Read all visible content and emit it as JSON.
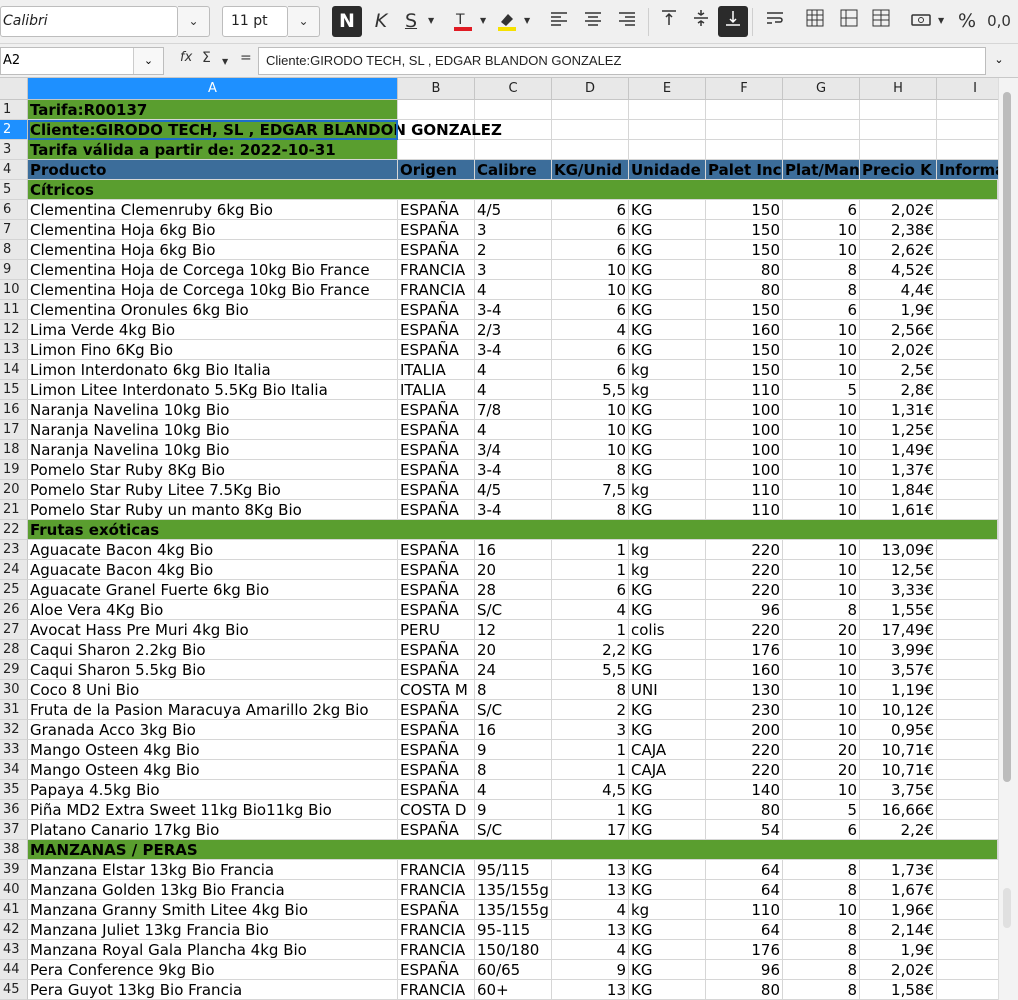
{
  "toolbar": {
    "font_name": "Calibri",
    "font_size": "11 pt",
    "bold_label": "N",
    "italic_label": "K",
    "underline_label": "S",
    "percent_label": "%",
    "decimals_label": "0,0"
  },
  "formula_bar": {
    "cell_ref": "A2",
    "fx_label": "fx",
    "sum_label": "Σ",
    "equals_label": "=",
    "content": "Cliente:GIRODO TECH, SL , EDGAR BLANDON GONZALEZ"
  },
  "columns": [
    "A",
    "B",
    "C",
    "D",
    "E",
    "F",
    "G",
    "H",
    "I"
  ],
  "header_row": [
    "Producto",
    "Origen",
    "Calibre",
    "KG/Unid",
    "Unidade",
    "Palet Inc",
    "Plat/Man",
    "Precio K",
    "Informa"
  ],
  "info_rows": [
    {
      "num": "1",
      "text": "Tarifa:R00137"
    },
    {
      "num": "2",
      "text": "Cliente:GIRODO TECH, SL , EDGAR BLANDON GONZALEZ"
    },
    {
      "num": "3",
      "text": "Tarifa válida a partir de: 2022-10-31"
    }
  ],
  "rows": [
    {
      "num": "5",
      "section": "Cítricos"
    },
    {
      "num": "6",
      "cells": [
        "Clementina Clemenruby 6kg  Bio",
        "ESPAÑA",
        "4/5",
        "6",
        "KG",
        "150",
        "6",
        "2,02€"
      ]
    },
    {
      "num": "7",
      "cells": [
        "Clementina Hoja 6kg Bio",
        "ESPAÑA",
        "3",
        "6",
        "KG",
        "150",
        "10",
        "2,38€"
      ]
    },
    {
      "num": "8",
      "cells": [
        "Clementina Hoja 6kg Bio",
        "ESPAÑA",
        "2",
        "6",
        "KG",
        "150",
        "10",
        "2,62€"
      ]
    },
    {
      "num": "9",
      "cells": [
        "Clementina Hoja de Corcega 10kg Bio France",
        "FRANCIA",
        "3",
        "10",
        "KG",
        "80",
        "8",
        "4,52€"
      ]
    },
    {
      "num": "10",
      "cells": [
        "Clementina Hoja de Corcega 10kg Bio France",
        "FRANCIA",
        "4",
        "10",
        "KG",
        "80",
        "8",
        "4,4€"
      ]
    },
    {
      "num": "11",
      "cells": [
        "Clementina Oronules 6kg Bio",
        "ESPAÑA",
        "3-4",
        "6",
        "KG",
        "150",
        "6",
        "1,9€"
      ]
    },
    {
      "num": "12",
      "cells": [
        "Lima Verde 4kg Bio",
        "ESPAÑA",
        "2/3",
        "4",
        "KG",
        "160",
        "10",
        "2,56€"
      ]
    },
    {
      "num": "13",
      "cells": [
        "Limon Fino 6Kg Bio",
        "ESPAÑA",
        "3-4",
        "6",
        "KG",
        "150",
        "10",
        "2,02€"
      ]
    },
    {
      "num": "14",
      "cells": [
        "Limon Interdonato 6kg Bio Italia",
        "ITALIA",
        "4",
        "6",
        "kg",
        "150",
        "10",
        "2,5€"
      ]
    },
    {
      "num": "15",
      "cells": [
        "Limon Litee Interdonato 5.5Kg Bio Italia",
        "ITALIA",
        "4",
        "5,5",
        "kg",
        "110",
        "5",
        "2,8€"
      ]
    },
    {
      "num": "16",
      "cells": [
        "Naranja Navelina 10kg Bio",
        "ESPAÑA",
        "7/8",
        "10",
        "KG",
        "100",
        "10",
        "1,31€"
      ]
    },
    {
      "num": "17",
      "cells": [
        "Naranja Navelina 10kg Bio",
        "ESPAÑA",
        "4",
        "10",
        "KG",
        "100",
        "10",
        "1,25€"
      ]
    },
    {
      "num": "18",
      "cells": [
        "Naranja Navelina 10kg Bio",
        "ESPAÑA",
        "3/4",
        "10",
        "KG",
        "100",
        "10",
        "1,49€"
      ]
    },
    {
      "num": "19",
      "cells": [
        "Pomelo Star Ruby 8Kg Bio",
        "ESPAÑA",
        "3-4",
        "8",
        "KG",
        "100",
        "10",
        "1,37€"
      ]
    },
    {
      "num": "20",
      "cells": [
        "Pomelo Star Ruby Litee 7.5Kg Bio",
        "ESPAÑA",
        "4/5",
        "7,5",
        "kg",
        "110",
        "10",
        "1,84€"
      ]
    },
    {
      "num": "21",
      "cells": [
        "Pomelo Star Ruby un manto 8Kg Bio",
        "ESPAÑA",
        "3-4",
        "8",
        "KG",
        "110",
        "10",
        "1,61€"
      ]
    },
    {
      "num": "22",
      "section": "Frutas exóticas"
    },
    {
      "num": "23",
      "cells": [
        "Aguacate Bacon 4kg Bio",
        "ESPAÑA",
        "16",
        "1",
        "kg",
        "220",
        "10",
        "13,09€"
      ]
    },
    {
      "num": "24",
      "cells": [
        "Aguacate Bacon 4kg Bio",
        "ESPAÑA",
        "20",
        "1",
        "kg",
        "220",
        "10",
        "12,5€"
      ]
    },
    {
      "num": "25",
      "cells": [
        "Aguacate Granel Fuerte 6kg Bio",
        "ESPAÑA",
        "28",
        "6",
        "KG",
        "220",
        "10",
        "3,33€"
      ]
    },
    {
      "num": "26",
      "cells": [
        "Aloe Vera 4Kg  Bio",
        "ESPAÑA",
        "S/C",
        "4",
        "KG",
        "96",
        "8",
        "1,55€"
      ]
    },
    {
      "num": "27",
      "cells": [
        "Avocat Hass Pre Muri 4kg Bio",
        "PERU",
        "12",
        "1",
        "colis",
        "220",
        "20",
        "17,49€"
      ]
    },
    {
      "num": "28",
      "cells": [
        "Caqui Sharon 2.2kg  Bio",
        "ESPAÑA",
        "20",
        "2,2",
        "KG",
        "176",
        "10",
        "3,99€"
      ]
    },
    {
      "num": "29",
      "cells": [
        "Caqui Sharon 5.5kg  Bio",
        "ESPAÑA",
        "24",
        "5,5",
        "KG",
        "160",
        "10",
        "3,57€"
      ]
    },
    {
      "num": "30",
      "cells": [
        "Coco 8 Uni  Bio",
        "COSTA M",
        "8",
        "8",
        "UNI",
        "130",
        "10",
        "1,19€"
      ]
    },
    {
      "num": "31",
      "cells": [
        "Fruta de la Pasion Maracuya Amarillo 2kg Bio",
        "ESPAÑA",
        "S/C",
        "2",
        "KG",
        "230",
        "10",
        "10,12€"
      ]
    },
    {
      "num": "32",
      "cells": [
        "Granada Acco 3kg Bio",
        "ESPAÑA",
        "16",
        "3",
        "KG",
        "200",
        "10",
        "0,95€"
      ]
    },
    {
      "num": "33",
      "cells": [
        "Mango Osteen 4kg Bio",
        "ESPAÑA",
        "9",
        "1",
        "CAJA",
        "220",
        "20",
        "10,71€"
      ]
    },
    {
      "num": "34",
      "cells": [
        "Mango Osteen 4kg Bio",
        "ESPAÑA",
        "8",
        "1",
        "CAJA",
        "220",
        "20",
        "10,71€"
      ]
    },
    {
      "num": "35",
      "cells": [
        "Papaya 4.5kg Bio",
        "ESPAÑA",
        "4",
        "4,5",
        "KG",
        "140",
        "10",
        "3,75€"
      ]
    },
    {
      "num": "36",
      "cells": [
        "Piña MD2 Extra Sweet 11kg Bio11kg Bio",
        "COSTA D",
        "9",
        "1",
        "KG",
        "80",
        "5",
        "16,66€"
      ]
    },
    {
      "num": "37",
      "cells": [
        "Platano Canario 17kg Bio",
        "ESPAÑA",
        "S/C",
        "17",
        "KG",
        "54",
        "6",
        "2,2€"
      ]
    },
    {
      "num": "38",
      "section": "MANZANAS / PERAS"
    },
    {
      "num": "39",
      "cells": [
        "Manzana Elstar 13kg Bio Francia",
        "FRANCIA",
        "95/115",
        "13",
        "KG",
        "64",
        "8",
        "1,73€"
      ]
    },
    {
      "num": "40",
      "cells": [
        "Manzana Golden 13kg Bio Francia",
        "FRANCIA",
        "135/155g",
        "13",
        "KG",
        "64",
        "8",
        "1,67€"
      ]
    },
    {
      "num": "41",
      "cells": [
        "Manzana Granny Smith Litee 4kg Bio",
        "ESPAÑA",
        "135/155g",
        "4",
        "kg",
        "110",
        "10",
        "1,96€"
      ]
    },
    {
      "num": "42",
      "cells": [
        "Manzana Juliet 13kg Francia Bio",
        "FRANCIA",
        "95-115",
        "13",
        "KG",
        "64",
        "8",
        "2,14€"
      ]
    },
    {
      "num": "43",
      "cells": [
        "Manzana Royal Gala Plancha 4kg Bio",
        "FRANCIA",
        "150/180",
        "4",
        "KG",
        "176",
        "8",
        "1,9€"
      ]
    },
    {
      "num": "44",
      "cells": [
        "Pera Conference 9kg Bio",
        "ESPAÑA",
        "60/65",
        "9",
        "KG",
        "96",
        "8",
        "2,02€"
      ]
    },
    {
      "num": "45",
      "cells": [
        "Pera Guyot 13kg Bio Francia",
        "FRANCIA",
        "60+",
        "13",
        "KG",
        "80",
        "8",
        "1,58€"
      ]
    }
  ],
  "colors": {
    "section_green": "#5a9e2f",
    "header_blue": "#3c6d9a",
    "selection": "#1e90ff"
  }
}
